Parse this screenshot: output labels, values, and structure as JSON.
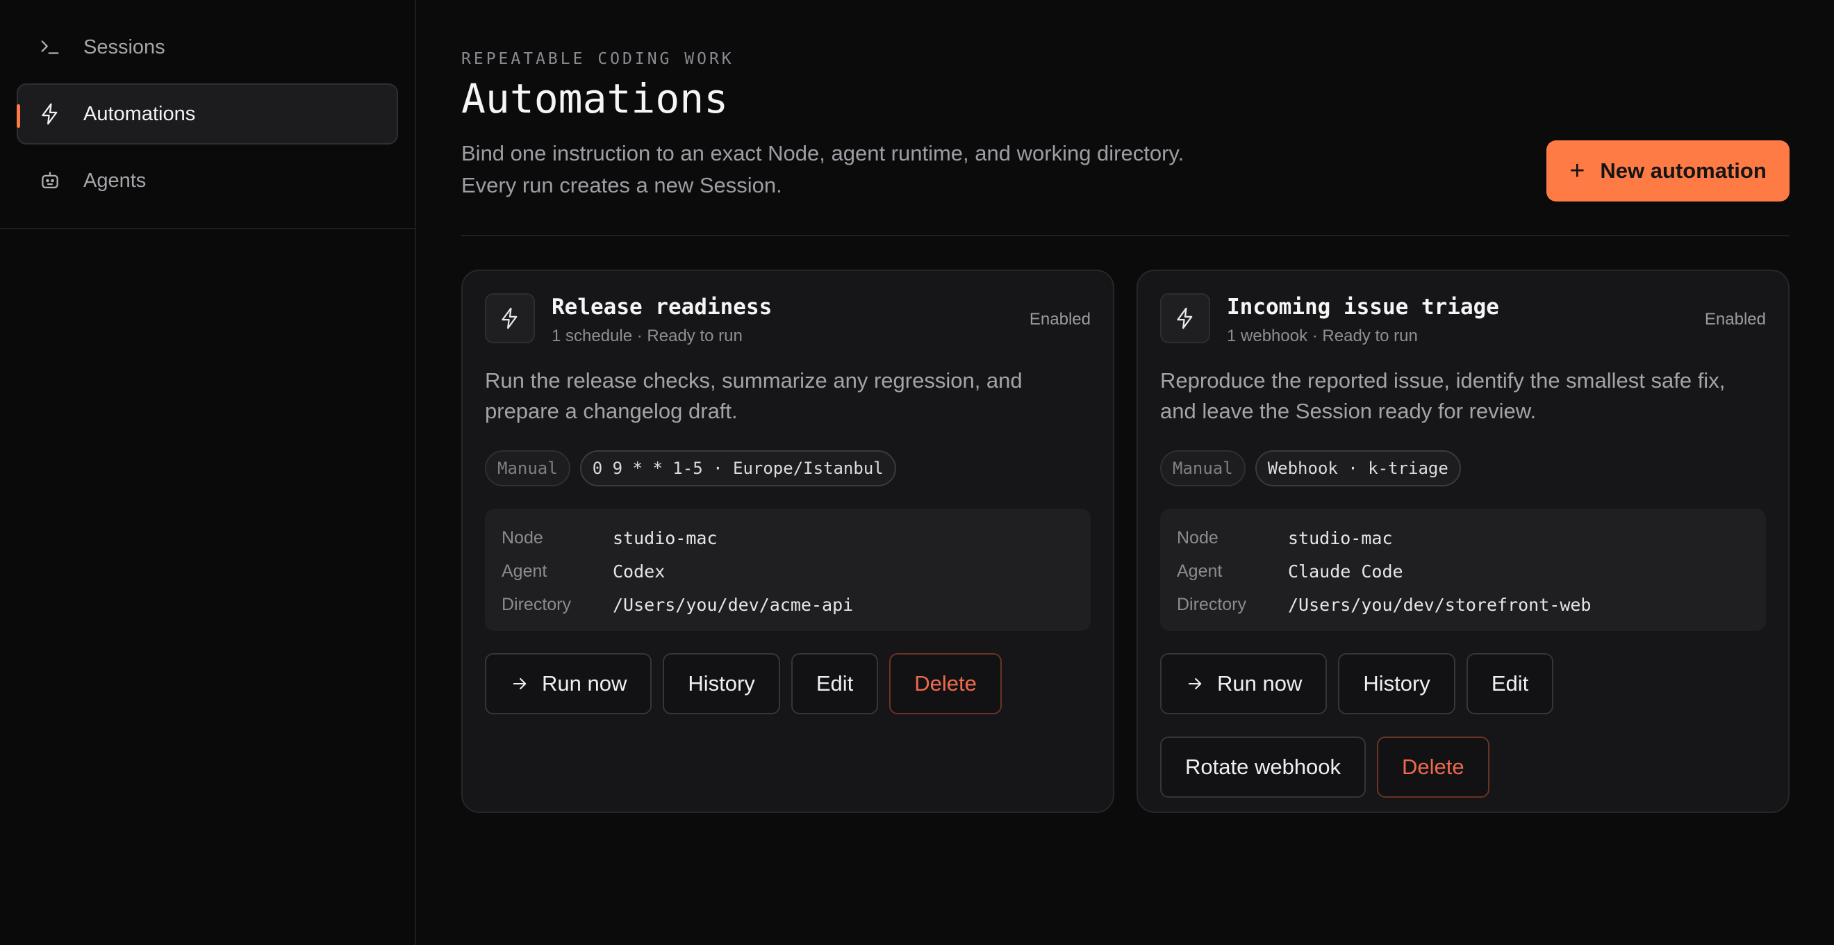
{
  "sidebar": {
    "items": [
      {
        "label": "Sessions",
        "icon": "terminal-prompt-icon"
      },
      {
        "label": "Automations",
        "icon": "lightning-bolt-icon",
        "active": true
      },
      {
        "label": "Agents",
        "icon": "robot-icon"
      }
    ]
  },
  "header": {
    "eyebrow": "REPEATABLE CODING WORK",
    "title": "Automations",
    "description_line1": "Bind one instruction to an exact Node, agent runtime, and working directory.",
    "description_line2": "Every run creates a new Session.",
    "new_button_label": "New automation"
  },
  "colors": {
    "accent": "#ff7b45",
    "danger": "#ef6a4c",
    "background": "#0b0b0c",
    "card": "#161618"
  },
  "cards": [
    {
      "title": "Release readiness",
      "subtitle": "1 schedule · Ready to run",
      "status": "Enabled",
      "description": "Run the release checks, summarize any regression, and prepare a changelog draft.",
      "tags": [
        "Manual",
        "0 9 * * 1-5 · Europe/Istanbul"
      ],
      "meta": {
        "node_label": "Node",
        "node": "studio-mac",
        "agent_label": "Agent",
        "agent": "Codex",
        "directory_label": "Directory",
        "directory": "/Users/you/dev/acme-api"
      },
      "actions": {
        "run": "Run now",
        "history": "History",
        "edit": "Edit",
        "delete": "Delete"
      }
    },
    {
      "title": "Incoming issue triage",
      "subtitle": "1 webhook · Ready to run",
      "status": "Enabled",
      "description": "Reproduce the reported issue, identify the smallest safe fix, and leave the Session ready for review.",
      "tags": [
        "Manual",
        "Webhook · k-triage"
      ],
      "meta": {
        "node_label": "Node",
        "node": "studio-mac",
        "agent_label": "Agent",
        "agent": "Claude Code",
        "directory_label": "Directory",
        "directory": "/Users/you/dev/storefront-web"
      },
      "actions": {
        "run": "Run now",
        "history": "History",
        "edit": "Edit",
        "rotate": "Rotate webhook",
        "delete": "Delete"
      }
    }
  ]
}
